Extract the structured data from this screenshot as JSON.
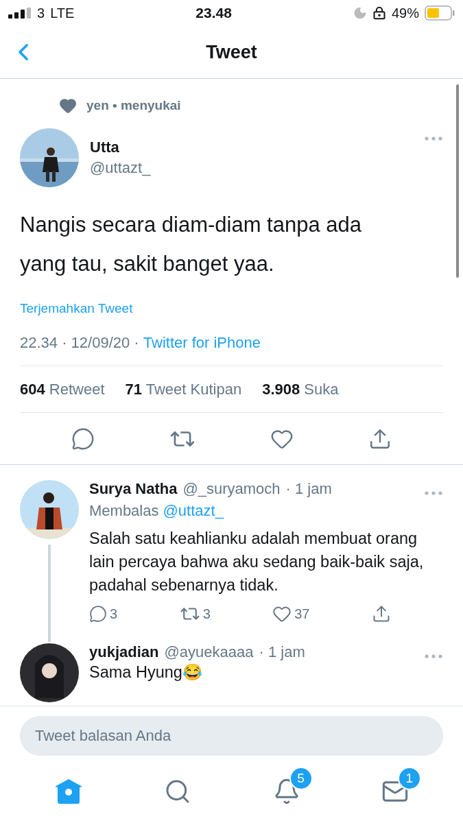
{
  "status_bar": {
    "carrier": "3",
    "network": "LTE",
    "time": "23.48",
    "battery": "49%"
  },
  "nav": {
    "title": "Tweet"
  },
  "social_context": "yen • menyukai",
  "tweet": {
    "name": "Utta",
    "handle": "@uttazt_",
    "text": "Nangis secara diam-diam tanpa ada yang tau, sakit banget yaa.",
    "translate": "Terjemahkan Tweet",
    "timestamp": "22.34 · 12/09/20 · ",
    "source": "Twitter for iPhone",
    "stats": [
      "**604** Retweet",
      "**71** Tweet Kutipan",
      "**3.908** Suka"
    ]
  },
  "replies": [
    {
      "name": "Surya Natha",
      "handle": "@_suryamoch",
      "time": "· 1 jam",
      "replying_label": "Membalas",
      "replying_to": "@uttazt_",
      "text": "Salah satu keahlianku adalah membuat orang lain percaya bahwa aku sedang baik-baik saja, padahal sebenarnya tidak.",
      "counts": {
        "reply": "3",
        "retweet": "3",
        "like": "37"
      }
    },
    {
      "name": "yukjadian",
      "handle": "@ayuekaaaa",
      "time": "· 1 jam",
      "text": "Sama Hyung😂"
    }
  ],
  "composer": {
    "placeholder": "Tweet balasan Anda"
  },
  "tab_bar": [
    {
      "kind": "home",
      "selected": true
    },
    {
      "kind": "search",
      "selected": false
    },
    {
      "kind": "notifications",
      "selected": false,
      "badge": "5"
    },
    {
      "kind": "messages",
      "selected": false,
      "badge": "1"
    }
  ]
}
